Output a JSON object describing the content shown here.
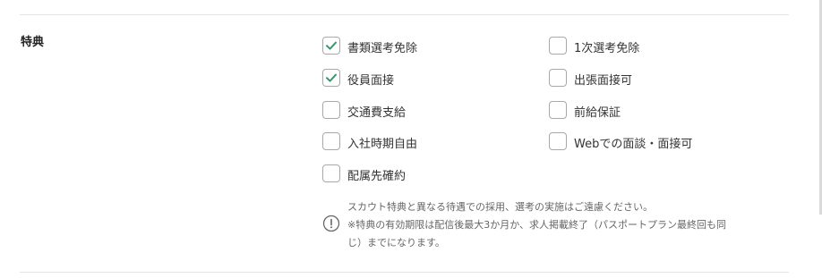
{
  "section": {
    "title": "特典"
  },
  "benefits": [
    {
      "label": "書類選考免除",
      "checked": true
    },
    {
      "label": "1次選考免除",
      "checked": false
    },
    {
      "label": "役員面接",
      "checked": true
    },
    {
      "label": "出張面接可",
      "checked": false
    },
    {
      "label": "交通費支給",
      "checked": false
    },
    {
      "label": "前給保証",
      "checked": false
    },
    {
      "label": "入社時期自由",
      "checked": false
    },
    {
      "label": "Webでの面談・面接可",
      "checked": false
    },
    {
      "label": "配属先確約",
      "checked": false
    }
  ],
  "notice": {
    "lines": [
      "スカウト特典と異なる待遇での採用、選考の実施はご遠慮ください。",
      "※特典の有効期限は配信後最大3か月か、求人掲載終了（パスポートプラン最終回も同",
      "じ）までになります。"
    ],
    "icon": "exclamation-circle-icon"
  },
  "colors": {
    "check": "#2e9e6a",
    "border": "#a8a8a8",
    "notice_text": "#666666"
  }
}
